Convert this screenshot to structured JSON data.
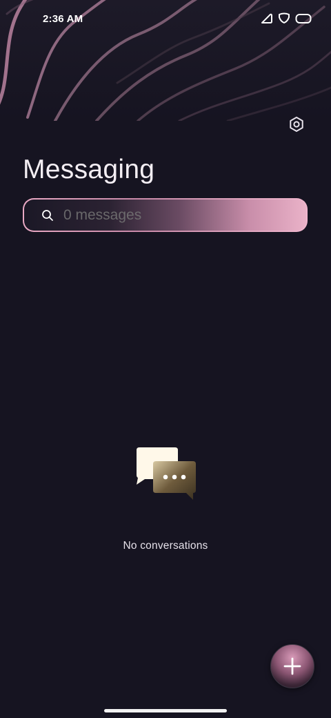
{
  "status_bar": {
    "time": "2:36 AM"
  },
  "header": {
    "title": "Messaging"
  },
  "search": {
    "placeholder": "0 messages"
  },
  "empty_state": {
    "text": "No conversations"
  },
  "icons": {
    "settings": "gear-icon",
    "search": "search-icon",
    "fab": "plus-icon",
    "empty": "chat-bubbles-icon"
  },
  "colors": {
    "background": "#161421",
    "accent_pink": "#e9a9c4",
    "text_primary": "#f3eef3"
  }
}
